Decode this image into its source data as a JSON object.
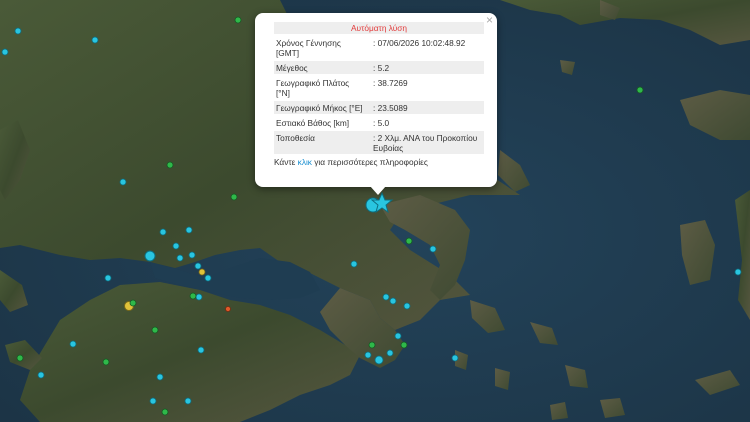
{
  "popup": {
    "title": "Αυτόματη λύση",
    "close_label": "×",
    "rows": [
      {
        "label": "Χρόνος Γέννησης [GMT]",
        "value": ": 07/06/2026 10:02:48.92"
      },
      {
        "label": "Μέγεθος",
        "value": ": 5.2"
      },
      {
        "label": "Γεωγραφικό Πλάτος [°N]",
        "value": ": 38.7269"
      },
      {
        "label": "Γεωγραφικό Μήκος [°E]",
        "value": ": 23.5089"
      },
      {
        "label": "Εστιακό Βάθος [km]",
        "value": ": 5.0"
      },
      {
        "label": "Τοποθεσία",
        "value": ": 2 Χλμ. ΑΝΑ του Προκοπίου Ευβοίας"
      }
    ],
    "more_prefix": "Κάντε ",
    "more_link": "κλικ",
    "more_suffix": " για περισσότερες πληροφορίες"
  },
  "colors": {
    "sea": "#1f3a4c",
    "land": "#3a4a30",
    "quake_recent": "#29c5e0",
    "quake_day": "#2fb84a",
    "quake_week": "#e0c23a",
    "quake_old": "#e05a2a",
    "epicenter_star": "#29c5e0"
  },
  "icons": {
    "epicenter": "star-icon",
    "close": "close-icon"
  }
}
